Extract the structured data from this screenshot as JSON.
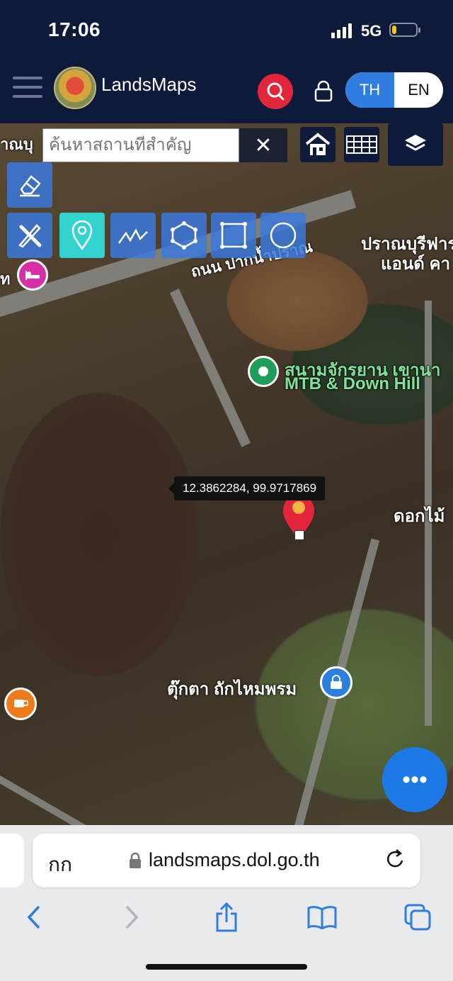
{
  "status": {
    "time": "17:06",
    "network": "5G",
    "battery_level": 0.2
  },
  "app": {
    "brand": "LandsMaps",
    "lang_th": "TH",
    "lang_en": "EN",
    "active_lang": "TH"
  },
  "search": {
    "placeholder": "ค้นหาสถานที่สำคัญ",
    "clear": "✕"
  },
  "map": {
    "labels": {
      "top_left": "าณบุ",
      "road": "ถนน ปากน้ำปราณ",
      "top_right_line1": "ปราณบุรีฟาร",
      "top_right_line2": "แอนด์ คา",
      "left_edge": "ท",
      "poi_name_line1": "สนามจักรยาน เขานา",
      "poi_name_line2": "MTB & Down Hill",
      "right_edge": "ดอกไม้",
      "shop": "ตุ๊กตา ถักไหมพรม"
    },
    "coordinates": "12.3862284, 99.9717869"
  },
  "tools": [
    "eraser-icon",
    "pencil-ruler-icon",
    "location-pin-icon",
    "polyline-icon",
    "polygon-icon",
    "rectangle-icon",
    "circle-icon"
  ],
  "fab": {
    "label": "•••"
  },
  "browser": {
    "aa": "กก",
    "url": "landsmaps.dol.go.th"
  },
  "colors": {
    "header_bg": "#0e1a3a",
    "accent_blue": "#2f7de1",
    "search_red": "#e2263a",
    "tool_blue": "#3b78dc",
    "tool_active": "#33d4d0"
  }
}
